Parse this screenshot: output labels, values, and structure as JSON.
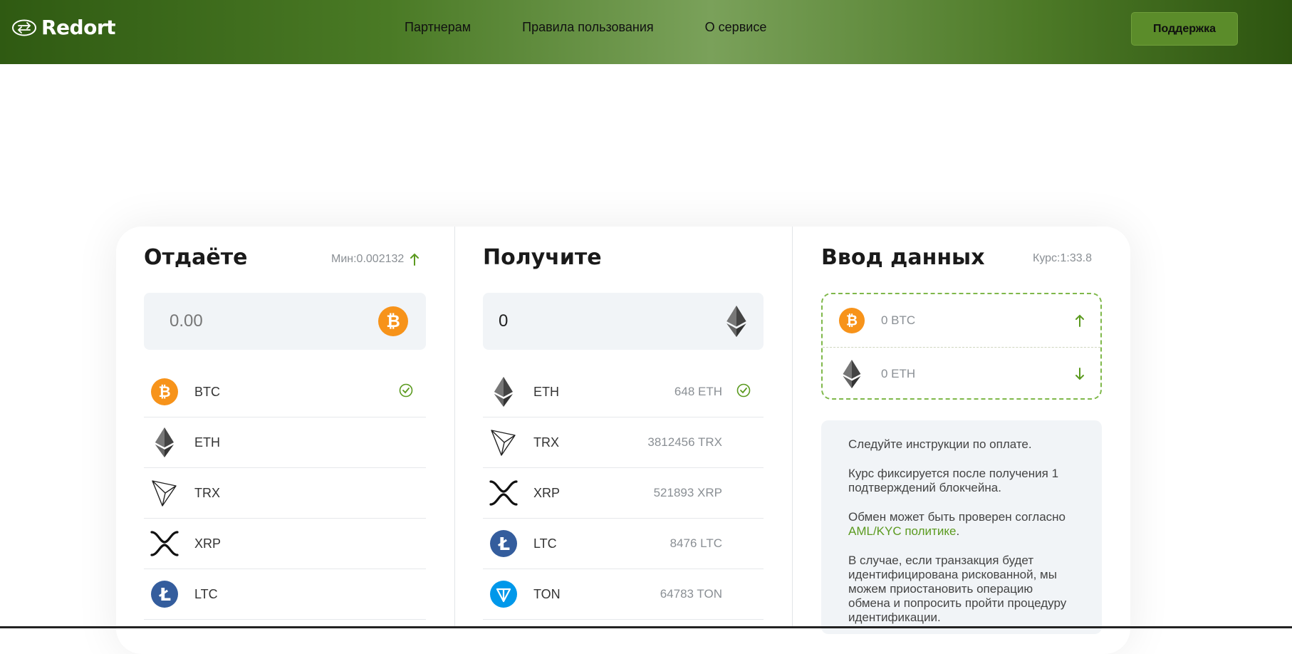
{
  "header": {
    "logo_text": "Redort",
    "nav": [
      "Партнерам",
      "Правила пользования",
      "О сервисе"
    ],
    "support_label": "Поддержка"
  },
  "give": {
    "title": "Отдаёте",
    "min_label": "Мин:0.002132",
    "amount_placeholder": "0.00",
    "selected_icon": "bitcoin-icon",
    "items": [
      {
        "symbol": "BTC",
        "icon": "bitcoin-icon",
        "selected": true
      },
      {
        "symbol": "ETH",
        "icon": "ethereum-icon"
      },
      {
        "symbol": "TRX",
        "icon": "tron-icon"
      },
      {
        "symbol": "XRP",
        "icon": "xrp-icon"
      },
      {
        "symbol": "LTC",
        "icon": "litecoin-icon"
      }
    ]
  },
  "get": {
    "title": "Получите",
    "amount_value": "0",
    "selected_icon": "ethereum-icon",
    "items": [
      {
        "symbol": "ETH",
        "reserve": "648 ETH",
        "icon": "ethereum-icon",
        "selected": true
      },
      {
        "symbol": "TRX",
        "reserve": "3812456 TRX",
        "icon": "tron-icon"
      },
      {
        "symbol": "XRP",
        "reserve": "521893 XRP",
        "icon": "xrp-icon"
      },
      {
        "symbol": "LTC",
        "reserve": "8476 LTC",
        "icon": "litecoin-icon"
      },
      {
        "symbol": "TON",
        "reserve": "64783 TON",
        "icon": "ton-icon"
      }
    ]
  },
  "data_entry": {
    "title": "Ввод данных",
    "rate_label": "Курс:1:33.8",
    "from_label": "0 BTC",
    "to_label": "0 ETH",
    "info": {
      "p1": "Следуйте инструкции по оплате.",
      "p2": "Курс фиксируется после получения 1 подтверждений блокчейна.",
      "p3_text": "Обмен может быть проверен согласно",
      "p3_link": "AML/KYC политике",
      "p3_end": ".",
      "p4": "В случае, если транзакция будет идентифицирована рискованной, мы можем приостановить операцию обмена и попросить пройти процедуру идентификации."
    }
  },
  "colors": {
    "accent": "#5b9a1f",
    "btc": "#f7931a",
    "ltc": "#345d9d",
    "ton": "#0098ea"
  }
}
